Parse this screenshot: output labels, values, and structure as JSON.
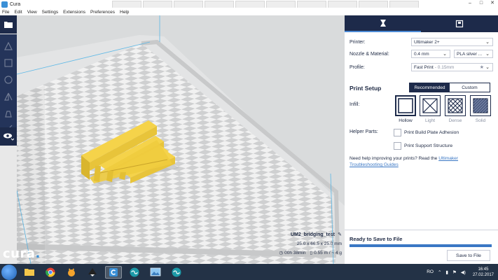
{
  "window": {
    "title": "Cura",
    "controls": [
      "–",
      "□",
      "✕"
    ]
  },
  "menubar": {
    "items": [
      "File",
      "Edit",
      "View",
      "Settings",
      "Extensions",
      "Preferences",
      "Help"
    ]
  },
  "right_panel": {
    "printer": {
      "label": "Printer:",
      "value": "Ultimaker 2+"
    },
    "nozzle_material": {
      "label": "Nozzle & Material:",
      "nozzle": "0.4 mm",
      "material": "PLA silver ..."
    },
    "profile": {
      "label": "Profile:",
      "name": "Fast Print",
      "detail": "- 0.15mm"
    },
    "print_setup": {
      "title": "Print Setup",
      "mode_recommended": "Recommended",
      "mode_custom": "Custom",
      "infill_label": "Infill:",
      "infill_options": [
        "Hollow",
        "Light",
        "Dense",
        "Solid"
      ],
      "infill_selected": "Hollow",
      "helper_label": "Helper Parts:",
      "adhesion_label": "Print Build Plate Adhesion",
      "support_label": "Print Support Structure",
      "help_prefix": "Need help improving your prints? Read the ",
      "help_link": "Ultimaker Troubleshooting Guides"
    },
    "save": {
      "title": "Ready to Save to File",
      "button": "Save to File",
      "progress": 1.0
    }
  },
  "job": {
    "name": "UM2_bridging_test",
    "dimensions": "25.0 x 66.5 x 25.0 mm",
    "time": "00h 38min",
    "material": "0.55 m / ~ 4 g"
  },
  "logo": {
    "text": "cura",
    "dot": "."
  },
  "taskbar": {
    "tray_lang": "RO",
    "clock_time": "16:45",
    "clock_date": "27.02.2017"
  },
  "colors": {
    "panel_dark": "#1d2a4a",
    "accent_blue": "#3a77c4",
    "model_yellow": "#f5d34a",
    "taskbar": "#233246"
  }
}
